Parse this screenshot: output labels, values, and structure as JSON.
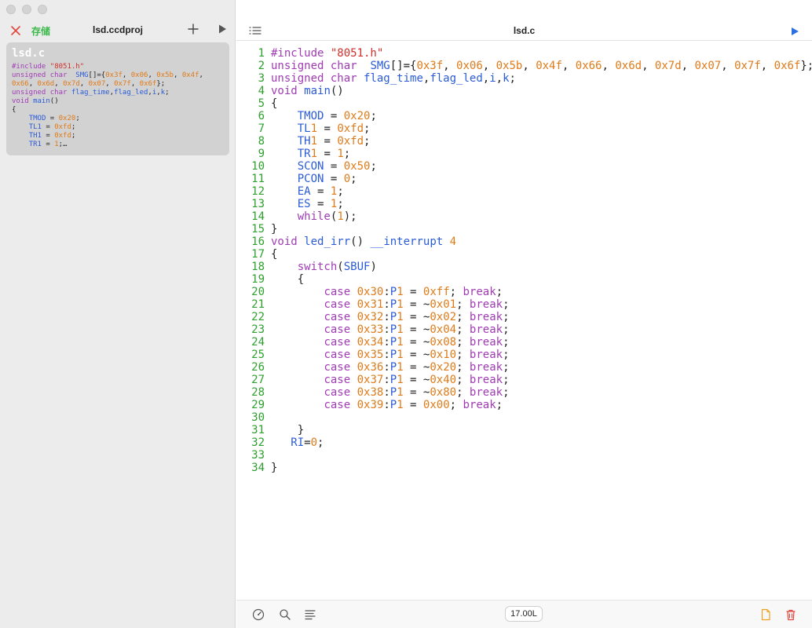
{
  "sidebar": {
    "save_label": "存储",
    "project_title": "lsd.ccdproj",
    "file_card": {
      "name": "lsd.c",
      "preview": [
        [
          [
            "#include ",
            "pp"
          ],
          [
            "\"8051.h\"",
            "str"
          ]
        ],
        [
          [
            "unsigned char ",
            "kw"
          ],
          [
            " SMG",
            "id"
          ],
          [
            "[]={",
            "plain"
          ],
          [
            "0x3f",
            "num"
          ],
          [
            ", ",
            "plain"
          ],
          [
            "0x06",
            "num"
          ],
          [
            ", ",
            "plain"
          ],
          [
            "0x5b",
            "num"
          ],
          [
            ", ",
            "plain"
          ],
          [
            "0x4f",
            "num"
          ],
          [
            ",",
            "plain"
          ]
        ],
        [
          [
            "0x66",
            "num"
          ],
          [
            ", ",
            "plain"
          ],
          [
            "0x6d",
            "num"
          ],
          [
            ", ",
            "plain"
          ],
          [
            "0x7d",
            "num"
          ],
          [
            ", ",
            "plain"
          ],
          [
            "0x07",
            "num"
          ],
          [
            ", ",
            "plain"
          ],
          [
            "0x7f",
            "num"
          ],
          [
            ", ",
            "plain"
          ],
          [
            "0x6f",
            "num"
          ],
          [
            "};",
            "plain"
          ]
        ],
        [
          [
            "unsigned char ",
            "kw"
          ],
          [
            "flag_time",
            "id"
          ],
          [
            ",",
            "plain"
          ],
          [
            "flag_led",
            "id"
          ],
          [
            ",",
            "plain"
          ],
          [
            "i",
            "id"
          ],
          [
            ",",
            "plain"
          ],
          [
            "k",
            "id"
          ],
          [
            ";",
            "plain"
          ]
        ],
        [
          [
            "void ",
            "kw"
          ],
          [
            "main",
            "fn"
          ],
          [
            "()",
            "plain"
          ]
        ],
        [
          [
            "{",
            "plain"
          ]
        ],
        [
          [
            "    ",
            "plain"
          ],
          [
            "TMOD",
            "id"
          ],
          [
            " = ",
            "plain"
          ],
          [
            "0x20",
            "num"
          ],
          [
            ";",
            "plain"
          ]
        ],
        [
          [
            "    ",
            "plain"
          ],
          [
            "TL1",
            "id"
          ],
          [
            " = ",
            "plain"
          ],
          [
            "0xfd",
            "num"
          ],
          [
            ";",
            "plain"
          ]
        ],
        [
          [
            "    ",
            "plain"
          ],
          [
            "TH1",
            "id"
          ],
          [
            " = ",
            "plain"
          ],
          [
            "0xfd",
            "num"
          ],
          [
            ";",
            "plain"
          ]
        ],
        [
          [
            "    ",
            "plain"
          ],
          [
            "TR1",
            "id"
          ],
          [
            " = ",
            "plain"
          ],
          [
            "1",
            "num"
          ],
          [
            ";…",
            "plain"
          ]
        ]
      ]
    }
  },
  "editor": {
    "title": "lsd.c",
    "footer_size": "17.00L",
    "lines": [
      [
        [
          "#include ",
          "pp"
        ],
        [
          "\"8051.h\"",
          "str"
        ]
      ],
      [
        [
          "unsigned char ",
          "kw"
        ],
        [
          " SMG",
          "id"
        ],
        [
          "[]={",
          "plain"
        ],
        [
          "0x3f",
          "num"
        ],
        [
          ", ",
          "plain"
        ],
        [
          "0x06",
          "num"
        ],
        [
          ", ",
          "plain"
        ],
        [
          "0x5b",
          "num"
        ],
        [
          ", ",
          "plain"
        ],
        [
          "0x4f",
          "num"
        ],
        [
          ", ",
          "plain"
        ],
        [
          "0x66",
          "num"
        ],
        [
          ", ",
          "plain"
        ],
        [
          "0x6d",
          "num"
        ],
        [
          ", ",
          "plain"
        ],
        [
          "0x7d",
          "num"
        ],
        [
          ", ",
          "plain"
        ],
        [
          "0x07",
          "num"
        ],
        [
          ", ",
          "plain"
        ],
        [
          "0x7f",
          "num"
        ],
        [
          ", ",
          "plain"
        ],
        [
          "0x6f",
          "num"
        ],
        [
          "};",
          "plain"
        ]
      ],
      [
        [
          "unsigned char ",
          "kw"
        ],
        [
          "flag_time",
          "id"
        ],
        [
          ",",
          "plain"
        ],
        [
          "flag_led",
          "id"
        ],
        [
          ",",
          "plain"
        ],
        [
          "i",
          "id"
        ],
        [
          ",",
          "plain"
        ],
        [
          "k",
          "id"
        ],
        [
          ";",
          "plain"
        ]
      ],
      [
        [
          "void ",
          "kw"
        ],
        [
          "main",
          "fn"
        ],
        [
          "()",
          "plain"
        ]
      ],
      [
        [
          "{",
          "plain"
        ]
      ],
      [
        [
          "    ",
          "plain"
        ],
        [
          "TMOD",
          "id"
        ],
        [
          " = ",
          "plain"
        ],
        [
          "0x20",
          "num"
        ],
        [
          ";",
          "plain"
        ]
      ],
      [
        [
          "    ",
          "plain"
        ],
        [
          "TL",
          "id"
        ],
        [
          "1",
          "num"
        ],
        [
          " = ",
          "plain"
        ],
        [
          "0xfd",
          "num"
        ],
        [
          ";",
          "plain"
        ]
      ],
      [
        [
          "    ",
          "plain"
        ],
        [
          "TH",
          "id"
        ],
        [
          "1",
          "num"
        ],
        [
          " = ",
          "plain"
        ],
        [
          "0xfd",
          "num"
        ],
        [
          ";",
          "plain"
        ]
      ],
      [
        [
          "    ",
          "plain"
        ],
        [
          "TR",
          "id"
        ],
        [
          "1",
          "num"
        ],
        [
          " = ",
          "plain"
        ],
        [
          "1",
          "num"
        ],
        [
          ";",
          "plain"
        ]
      ],
      [
        [
          "    ",
          "plain"
        ],
        [
          "SCON",
          "id"
        ],
        [
          " = ",
          "plain"
        ],
        [
          "0x50",
          "num"
        ],
        [
          ";",
          "plain"
        ]
      ],
      [
        [
          "    ",
          "plain"
        ],
        [
          "PCON",
          "id"
        ],
        [
          " = ",
          "plain"
        ],
        [
          "0",
          "num"
        ],
        [
          ";",
          "plain"
        ]
      ],
      [
        [
          "    ",
          "plain"
        ],
        [
          "EA",
          "id"
        ],
        [
          " = ",
          "plain"
        ],
        [
          "1",
          "num"
        ],
        [
          ";",
          "plain"
        ]
      ],
      [
        [
          "    ",
          "plain"
        ],
        [
          "ES",
          "id"
        ],
        [
          " = ",
          "plain"
        ],
        [
          "1",
          "num"
        ],
        [
          ";",
          "plain"
        ]
      ],
      [
        [
          "    ",
          "plain"
        ],
        [
          "while",
          "kw"
        ],
        [
          "(",
          "plain"
        ],
        [
          "1",
          "num"
        ],
        [
          ");",
          "plain"
        ]
      ],
      [
        [
          "}",
          "plain"
        ]
      ],
      [
        [
          "void ",
          "kw"
        ],
        [
          "led_irr",
          "fn"
        ],
        [
          "() ",
          "plain"
        ],
        [
          "__interrupt",
          "id"
        ],
        [
          " ",
          "plain"
        ],
        [
          "4",
          "num"
        ]
      ],
      [
        [
          "{",
          "plain"
        ]
      ],
      [
        [
          "    ",
          "plain"
        ],
        [
          "switch",
          "kw"
        ],
        [
          "(",
          "plain"
        ],
        [
          "SBUF",
          "id"
        ],
        [
          ")",
          "plain"
        ]
      ],
      [
        [
          "    {",
          "plain"
        ]
      ],
      [
        [
          "        ",
          "plain"
        ],
        [
          "case ",
          "kw"
        ],
        [
          "0x30",
          "num"
        ],
        [
          ":",
          "plain"
        ],
        [
          "P",
          "id"
        ],
        [
          "1",
          "num"
        ],
        [
          " = ",
          "plain"
        ],
        [
          "0xff",
          "num"
        ],
        [
          "; ",
          "plain"
        ],
        [
          "break",
          "kw"
        ],
        [
          ";",
          "plain"
        ]
      ],
      [
        [
          "        ",
          "plain"
        ],
        [
          "case ",
          "kw"
        ],
        [
          "0x31",
          "num"
        ],
        [
          ":",
          "plain"
        ],
        [
          "P",
          "id"
        ],
        [
          "1",
          "num"
        ],
        [
          " = ~",
          "plain"
        ],
        [
          "0x01",
          "num"
        ],
        [
          "; ",
          "plain"
        ],
        [
          "break",
          "kw"
        ],
        [
          ";",
          "plain"
        ]
      ],
      [
        [
          "        ",
          "plain"
        ],
        [
          "case ",
          "kw"
        ],
        [
          "0x32",
          "num"
        ],
        [
          ":",
          "plain"
        ],
        [
          "P",
          "id"
        ],
        [
          "1",
          "num"
        ],
        [
          " = ~",
          "plain"
        ],
        [
          "0x02",
          "num"
        ],
        [
          "; ",
          "plain"
        ],
        [
          "break",
          "kw"
        ],
        [
          ";",
          "plain"
        ]
      ],
      [
        [
          "        ",
          "plain"
        ],
        [
          "case ",
          "kw"
        ],
        [
          "0x33",
          "num"
        ],
        [
          ":",
          "plain"
        ],
        [
          "P",
          "id"
        ],
        [
          "1",
          "num"
        ],
        [
          " = ~",
          "plain"
        ],
        [
          "0x04",
          "num"
        ],
        [
          "; ",
          "plain"
        ],
        [
          "break",
          "kw"
        ],
        [
          ";",
          "plain"
        ]
      ],
      [
        [
          "        ",
          "plain"
        ],
        [
          "case ",
          "kw"
        ],
        [
          "0x34",
          "num"
        ],
        [
          ":",
          "plain"
        ],
        [
          "P",
          "id"
        ],
        [
          "1",
          "num"
        ],
        [
          " = ~",
          "plain"
        ],
        [
          "0x08",
          "num"
        ],
        [
          "; ",
          "plain"
        ],
        [
          "break",
          "kw"
        ],
        [
          ";",
          "plain"
        ]
      ],
      [
        [
          "        ",
          "plain"
        ],
        [
          "case ",
          "kw"
        ],
        [
          "0x35",
          "num"
        ],
        [
          ":",
          "plain"
        ],
        [
          "P",
          "id"
        ],
        [
          "1",
          "num"
        ],
        [
          " = ~",
          "plain"
        ],
        [
          "0x10",
          "num"
        ],
        [
          "; ",
          "plain"
        ],
        [
          "break",
          "kw"
        ],
        [
          ";",
          "plain"
        ]
      ],
      [
        [
          "        ",
          "plain"
        ],
        [
          "case ",
          "kw"
        ],
        [
          "0x36",
          "num"
        ],
        [
          ":",
          "plain"
        ],
        [
          "P",
          "id"
        ],
        [
          "1",
          "num"
        ],
        [
          " = ~",
          "plain"
        ],
        [
          "0x20",
          "num"
        ],
        [
          "; ",
          "plain"
        ],
        [
          "break",
          "kw"
        ],
        [
          ";",
          "plain"
        ]
      ],
      [
        [
          "        ",
          "plain"
        ],
        [
          "case ",
          "kw"
        ],
        [
          "0x37",
          "num"
        ],
        [
          ":",
          "plain"
        ],
        [
          "P",
          "id"
        ],
        [
          "1",
          "num"
        ],
        [
          " = ~",
          "plain"
        ],
        [
          "0x40",
          "num"
        ],
        [
          "; ",
          "plain"
        ],
        [
          "break",
          "kw"
        ],
        [
          ";",
          "plain"
        ]
      ],
      [
        [
          "        ",
          "plain"
        ],
        [
          "case ",
          "kw"
        ],
        [
          "0x38",
          "num"
        ],
        [
          ":",
          "plain"
        ],
        [
          "P",
          "id"
        ],
        [
          "1",
          "num"
        ],
        [
          " = ~",
          "plain"
        ],
        [
          "0x80",
          "num"
        ],
        [
          "; ",
          "plain"
        ],
        [
          "break",
          "kw"
        ],
        [
          ";",
          "plain"
        ]
      ],
      [
        [
          "        ",
          "plain"
        ],
        [
          "case ",
          "kw"
        ],
        [
          "0x39",
          "num"
        ],
        [
          ":",
          "plain"
        ],
        [
          "P",
          "id"
        ],
        [
          "1",
          "num"
        ],
        [
          " = ",
          "plain"
        ],
        [
          "0x00",
          "num"
        ],
        [
          "; ",
          "plain"
        ],
        [
          "break",
          "kw"
        ],
        [
          ";",
          "plain"
        ]
      ],
      [
        [
          "",
          "plain"
        ]
      ],
      [
        [
          "    }",
          "plain"
        ]
      ],
      [
        [
          "   ",
          "plain"
        ],
        [
          "RI",
          "id"
        ],
        [
          "=",
          "plain"
        ],
        [
          "0",
          "num"
        ],
        [
          ";",
          "plain"
        ]
      ],
      [
        [
          "",
          "plain"
        ]
      ],
      [
        [
          "}",
          "plain"
        ]
      ]
    ]
  },
  "icons": {
    "close": "close-icon",
    "add": "plus-icon",
    "run": "play-icon",
    "list": "list-icon",
    "settings": "gauge-icon",
    "search": "search-icon",
    "format": "align-icon",
    "new_file": "file-icon",
    "delete": "trash-icon"
  },
  "colors": {
    "save": "#3cb94b",
    "close": "#e0443a",
    "run_right": "#2b6fe0",
    "line_number": "#2fa02f",
    "file_icon": "#f0a020",
    "trash_icon": "#e0443a"
  }
}
